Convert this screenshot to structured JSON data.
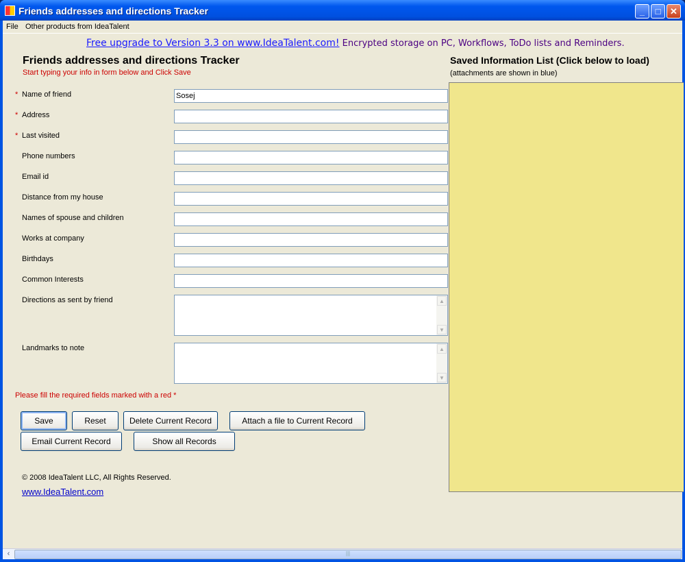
{
  "window": {
    "title": "Friends addresses and directions Tracker",
    "minimize": "_",
    "maximize": "□",
    "close": "✕"
  },
  "menu": [
    "File",
    "Other products from IdeaTalent"
  ],
  "promo": {
    "link": "Free upgrade to Version 3.3 on www.IdeaTalent.com!",
    "text": " Encrypted storage on PC, Workflows, ToDo lists and Reminders."
  },
  "form": {
    "title": "Friends addresses and directions Tracker",
    "subtitle": "Start typing your info in form below and Click Save",
    "fields": [
      {
        "label": "Name of friend",
        "required": true,
        "value": "Sosej"
      },
      {
        "label": "Address",
        "required": true,
        "value": ""
      },
      {
        "label": "Last visited",
        "required": true,
        "value": ""
      },
      {
        "label": "Phone numbers",
        "required": false,
        "value": ""
      },
      {
        "label": "Email id",
        "required": false,
        "value": ""
      },
      {
        "label": "Distance from my house",
        "required": false,
        "value": ""
      },
      {
        "label": "Names of spouse and children",
        "required": false,
        "value": ""
      },
      {
        "label": "Works at company",
        "required": false,
        "value": ""
      },
      {
        "label": "Birthdays",
        "required": false,
        "value": ""
      },
      {
        "label": "Common Interests",
        "required": false,
        "value": ""
      }
    ],
    "textareas": [
      {
        "label": "Directions as sent by friend",
        "value": ""
      },
      {
        "label": "Landmarks to note",
        "value": ""
      }
    ],
    "required_marker": "*",
    "warning": "Please fill the required fields marked with a red *"
  },
  "buttons": {
    "save": "Save",
    "reset": "Reset",
    "delete": "Delete Current Record",
    "attach": "Attach a file to Current Record",
    "email": "Email Current Record",
    "show_all": "Show all Records"
  },
  "saved_list": {
    "title": "Saved Information List (Click below to load)",
    "subtitle": "(attachments are shown in blue)",
    "items": []
  },
  "footer": {
    "copyright": "© 2008 IdeaTalent LLC, All Rights Reserved.",
    "link": "www.IdeaTalent.com"
  },
  "colors": {
    "list_bg": "#F0E68C",
    "required": "#CC0000"
  }
}
